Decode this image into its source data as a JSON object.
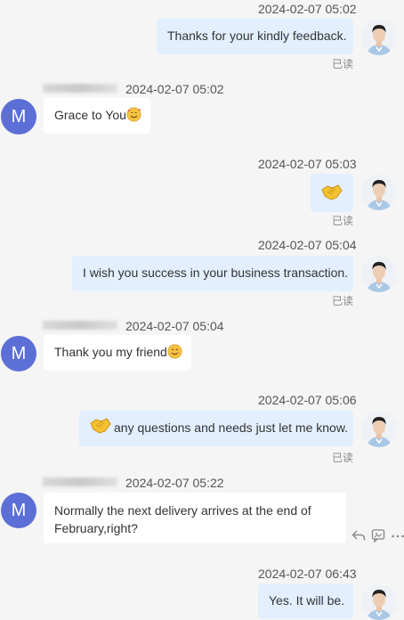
{
  "messages": [
    {
      "time": "2024-02-07 05:02",
      "text": "Thanks for your kindly feedback.",
      "read": "已读"
    },
    {
      "time": "2024-02-07 05:02",
      "text": "Grace to You",
      "avatar_letter": "M"
    },
    {
      "time": "2024-02-07 05:03",
      "read": "已读"
    },
    {
      "time": "2024-02-07 05:04",
      "text": "I wish you success in your business transaction.",
      "read": "已读"
    },
    {
      "time": "2024-02-07 05:04",
      "text": "Thank you my friend",
      "avatar_letter": "M"
    },
    {
      "time": "2024-02-07 05:06",
      "text": "any questions and needs just let me know.",
      "read": "已读"
    },
    {
      "time": "2024-02-07 05:22",
      "text_line1": "Normally the next delivery arrives at the end of",
      "text_line2": "February,right?",
      "avatar_letter": "M"
    },
    {
      "time": "2024-02-07 06:43",
      "text": "Yes. It will be."
    }
  ],
  "colors": {
    "background": "#f5f5f5",
    "outgoing_bubble": "#e3efff",
    "incoming_bubble": "#ffffff",
    "avatar": "#5c6fd6"
  },
  "icons": {
    "reply": "reply-icon",
    "quote": "quote-icon",
    "more": "more-icon",
    "handshake": "handshake-emoji",
    "smile_hearts": "smiling-face-with-hearts-emoji",
    "smile": "smiling-face-emoji"
  }
}
